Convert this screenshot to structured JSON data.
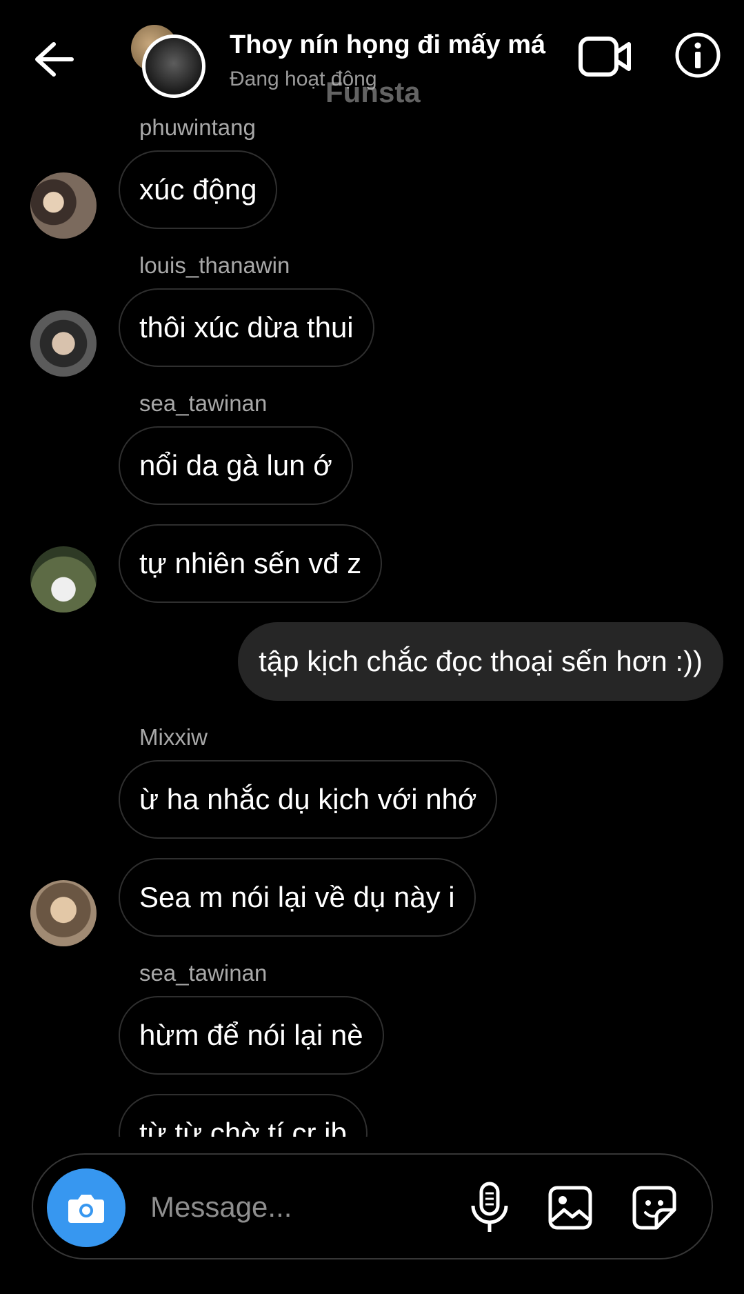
{
  "header": {
    "title": "Thoy nín họng đi mấy má",
    "status": "Đang hoạt động",
    "watermark": "Funsta"
  },
  "messages": [
    {
      "sender": "phuwintang",
      "text": "xúc động",
      "avatar": true
    },
    {
      "sender": "louis_thanawin",
      "text": "thôi xúc dừa thui",
      "avatar": true
    },
    {
      "sender": "sea_tawinan",
      "text": "nổi da gà lun ớ",
      "avatar": false
    },
    {
      "sender": "",
      "text": "tự nhiên sến vđ z",
      "avatar": true
    },
    {
      "sender": "",
      "text": "tập kịch chắc đọc thoại sến hơn :))",
      "mine": true
    },
    {
      "sender": "Mixxiw",
      "text": "ừ ha nhắc dụ kịch với nhớ",
      "avatar": false
    },
    {
      "sender": "",
      "text": "Sea m nói lại về dụ này i",
      "avatar": true
    },
    {
      "sender": "sea_tawinan",
      "text": "hừm để nói lại nè",
      "avatar": false
    },
    {
      "sender": "",
      "text": "từ từ chờ tí cr ib",
      "avatar": false
    }
  ],
  "composer": {
    "placeholder": "Message..."
  },
  "icons": {
    "back": "arrow-left-icon",
    "video": "video-camera-icon",
    "info": "info-icon",
    "camera": "camera-icon",
    "mic": "microphone-icon",
    "gallery": "image-icon",
    "sticker": "sticker-icon"
  },
  "colors": {
    "background": "#000000",
    "accent": "#3797f0",
    "own_bubble": "#262626",
    "bubble_border": "#2f2f2f",
    "muted_text": "#a8a8a8"
  }
}
